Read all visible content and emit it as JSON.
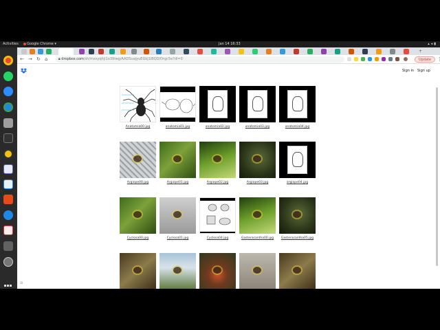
{
  "topbar": {
    "activities": "Activities",
    "app_name": "Google Chrome ▾",
    "clock": "Jan 14  16:33"
  },
  "browser": {
    "url_host": "dropbox.com",
    "url_path": "/sh/mxsyqhjl1o39iwg/AADSuajyuEGkJ1iBQD/Drgc5e?dl=0",
    "update_label": "Update"
  },
  "page": {
    "sign_in": "Sign in",
    "sign_up": "Sign up",
    "files": [
      {
        "name": "Anatomia00.jpg",
        "style": "diagram"
      },
      {
        "name": "anatomia01.jpg",
        "style": "diagram-wide"
      },
      {
        "name": "anatomia02.jpg",
        "style": "diagram-black"
      },
      {
        "name": "anatomia03.jpg",
        "style": "diagram-black"
      },
      {
        "name": "anatomia04.jpg",
        "style": "diagram-black"
      },
      {
        "name": "Argiope00.jpg",
        "style": "photo-fence"
      },
      {
        "name": "Argiope01.jpg",
        "style": "photo-green"
      },
      {
        "name": "Argiope02.jpg",
        "style": "photo-leaf"
      },
      {
        "name": "Argiope03.jpg",
        "style": "photo-dark"
      },
      {
        "name": "argiope04.jpg",
        "style": "diagram-black"
      },
      {
        "name": "Cyclosa00.jpg",
        "style": "photo-green"
      },
      {
        "name": "Cyclosa01.jpg",
        "style": "photo-gray"
      },
      {
        "name": "Cyclosa04.jpg",
        "style": "diagram-plain"
      },
      {
        "name": "Gasteracantha00.jpg",
        "style": "photo-leaf"
      },
      {
        "name": "Gasteracantha05.jpg",
        "style": "photo-dark"
      },
      {
        "name": "",
        "style": "photo-brown"
      },
      {
        "name": "",
        "style": "photo-sky"
      },
      {
        "name": "",
        "style": "photo-blur"
      },
      {
        "name": "",
        "style": "photo-rock"
      },
      {
        "name": "",
        "style": "photo-brown"
      }
    ]
  },
  "colors": {
    "accent": "#1a73e8",
    "dropbox_blue": "#0061fe",
    "update_red": "#c0392b"
  }
}
